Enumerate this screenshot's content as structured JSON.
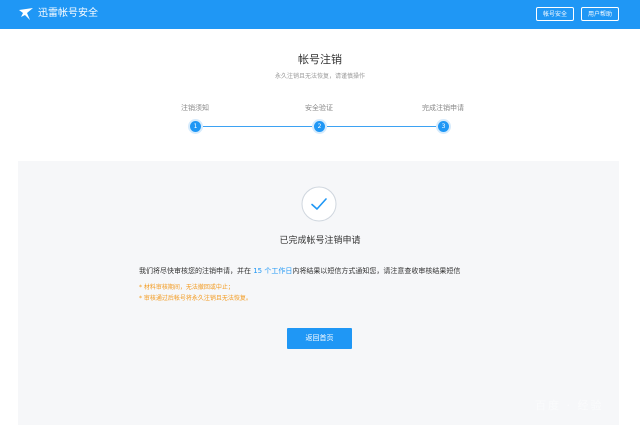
{
  "header": {
    "brand": "迅雷帐号安全",
    "nav": {
      "account_security": "帐号安全",
      "user_help": "用户帮助"
    }
  },
  "page": {
    "title": "帐号注销",
    "subtitle": "永久注销且无法恢复，请谨慎操作"
  },
  "steps": [
    {
      "label": "注销须知",
      "number": "1"
    },
    {
      "label": "安全验证",
      "number": "2"
    },
    {
      "label": "完成注销申请",
      "number": "3"
    }
  ],
  "result": {
    "title": "已完成帐号注销申请",
    "message_pre": "我们将尽快审核您的注销申请，并在",
    "message_days": " 15 个工作日",
    "message_post": "内将结果以短信方式通知您，请注意查收审核结果短信",
    "notes": [
      "* 材料审核期间，无法撤回或中止；",
      "* 审核通过后帐号将永久注销且无法恢复。"
    ],
    "back_button": "返回首页"
  },
  "watermark": "百度 · 经验",
  "colors": {
    "accent": "#1f97f5",
    "warning": "#f39a1e",
    "panel_bg": "#f6f7f9"
  }
}
